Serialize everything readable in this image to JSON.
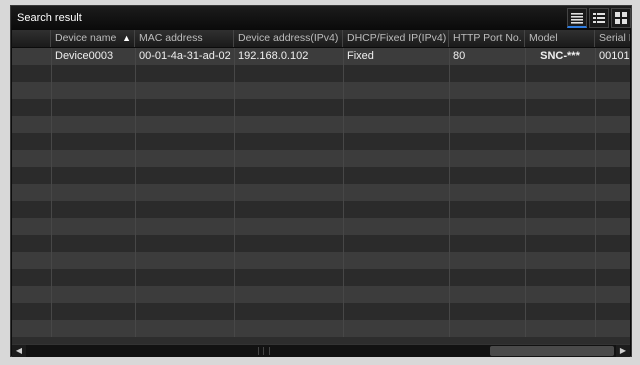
{
  "window": {
    "title": "Search result"
  },
  "view_buttons": [
    {
      "name": "list-view-icon",
      "active": true
    },
    {
      "name": "detail-view-icon",
      "active": false
    },
    {
      "name": "thumbnail-view-icon",
      "active": false
    }
  ],
  "table": {
    "columns": [
      "",
      "Device name",
      "MAC address",
      "Device address(IPv4)",
      "DHCP/Fixed IP(IPv4)",
      "HTTP Port No.",
      "Model",
      "Serial N"
    ],
    "sort": {
      "column": "Device name",
      "direction": "ascending",
      "icon": "sort-up-icon"
    },
    "rows": [
      {
        "device_name": "Device0003",
        "mac": "00-01-4a-31-ad-02",
        "ip": "192.168.0.102",
        "dhcp": "Fixed",
        "port": "80",
        "model": "SNC-***",
        "serial": "00101"
      }
    ],
    "empty_row_count": 16
  },
  "scrollbar": {
    "left_icon": "scroll-left-icon",
    "right_icon": "scroll-right-icon"
  }
}
